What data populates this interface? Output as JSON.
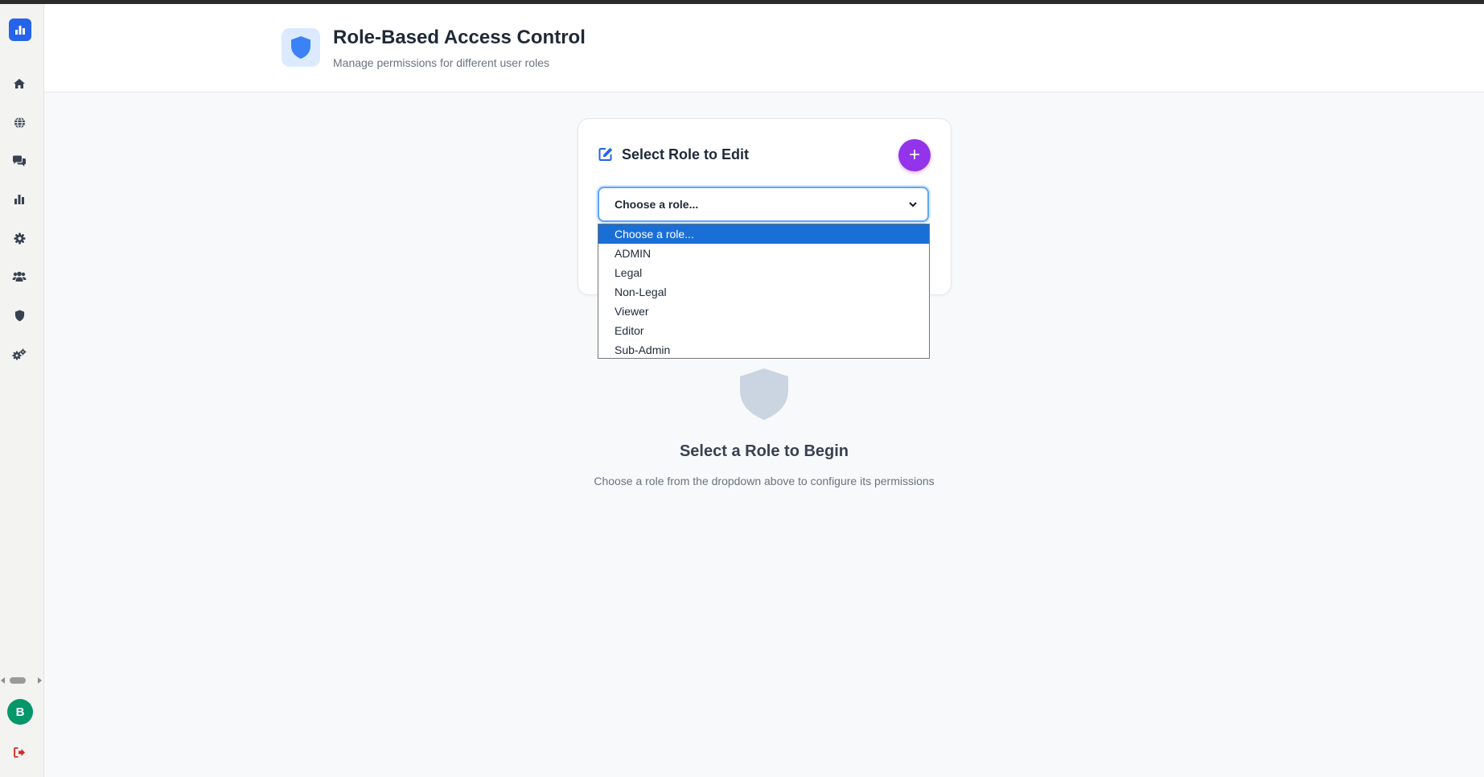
{
  "header": {
    "title": "Role-Based Access Control",
    "subtitle": "Manage permissions for different user roles"
  },
  "sidebar": {
    "items": [
      {
        "icon": "home-icon"
      },
      {
        "icon": "globe-icon"
      },
      {
        "icon": "chat-icon"
      },
      {
        "icon": "bar-chart-icon"
      },
      {
        "icon": "gear-icon"
      },
      {
        "icon": "users-icon"
      },
      {
        "icon": "shield-icon"
      },
      {
        "icon": "gears-icon"
      }
    ],
    "avatar_initial": "B",
    "logout_icon": "sign-out-icon"
  },
  "card": {
    "title": "Select Role to Edit",
    "add_label": "+",
    "select_value": "Choose a role..."
  },
  "dropdown": {
    "options": [
      "Choose a role...",
      "ADMIN",
      "Legal",
      "Non-Legal",
      "Viewer",
      "Editor",
      "Sub-Admin"
    ],
    "selected_index": 0
  },
  "empty_state": {
    "title": "Select a Role to Begin",
    "description": "Choose a role from the dropdown above to configure its permissions"
  },
  "colors": {
    "accent_blue": "#2563eb",
    "add_button": "#9333ea",
    "avatar": "#059669",
    "selected_option": "#1a6fd6",
    "logout": "#dc2626"
  }
}
